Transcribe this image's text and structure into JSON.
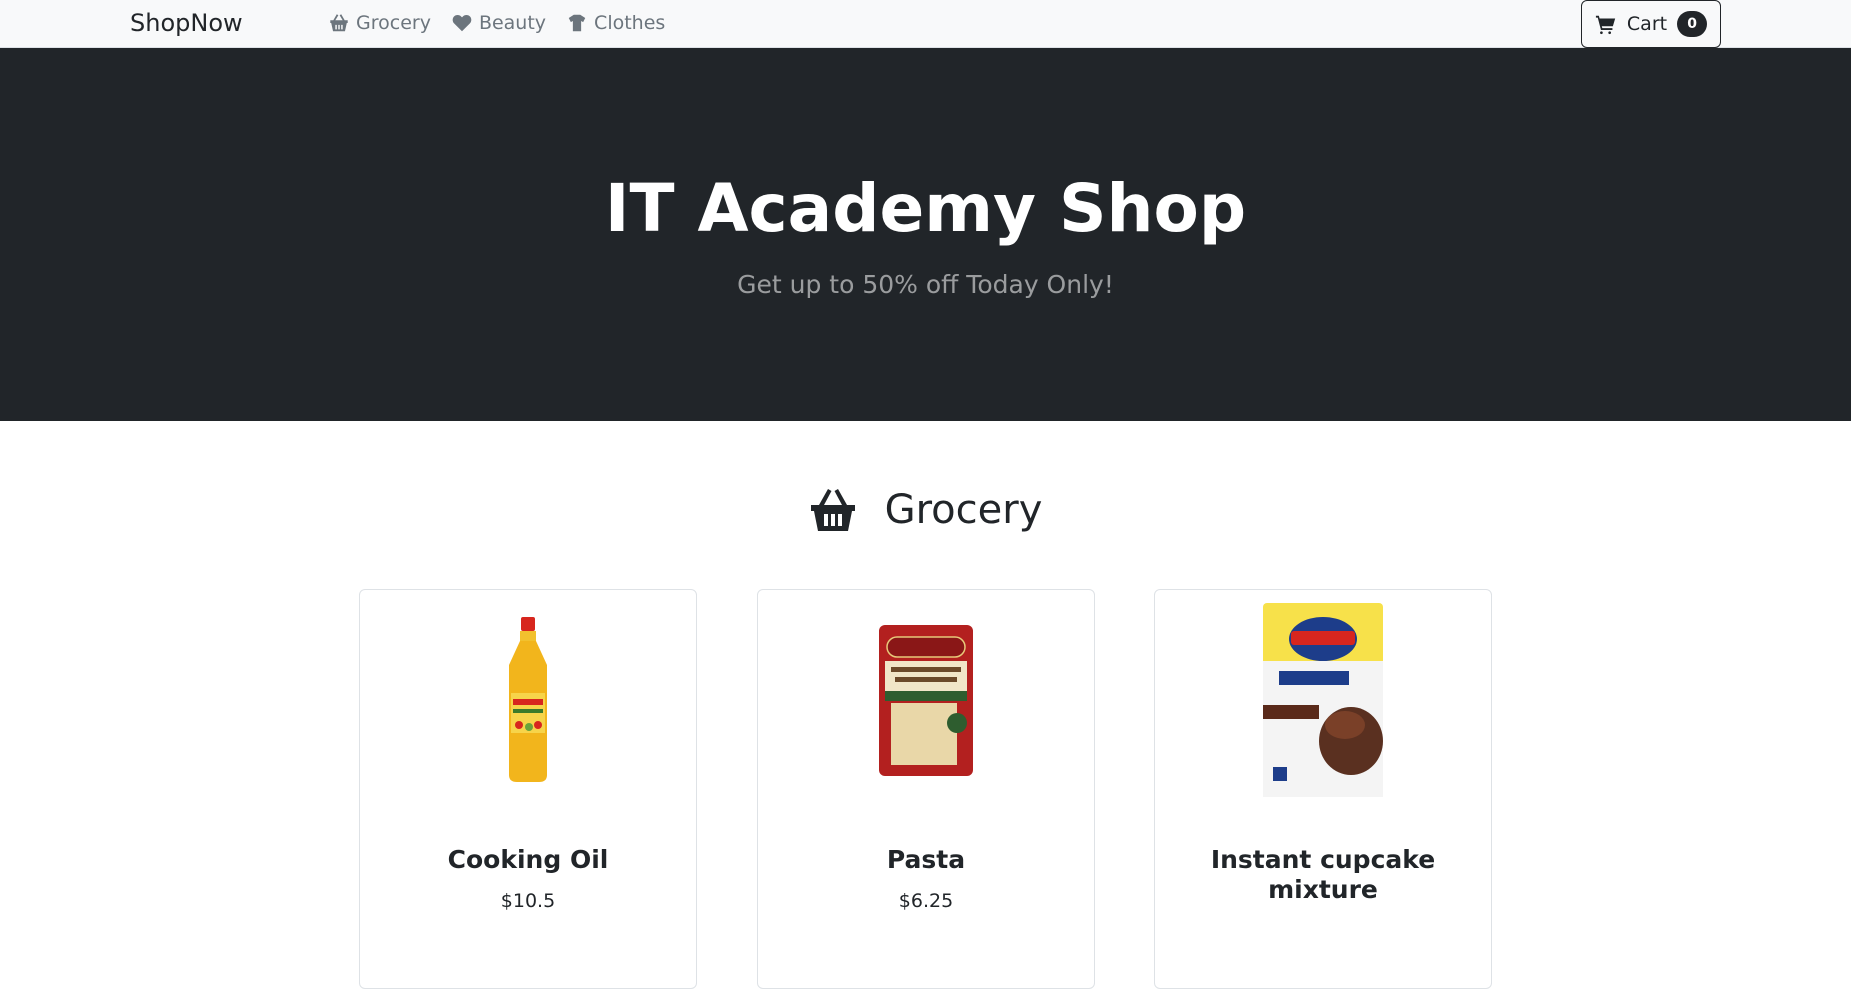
{
  "nav": {
    "brand": "ShopNow",
    "links": [
      {
        "label": "Grocery",
        "icon": "basket-icon"
      },
      {
        "label": "Beauty",
        "icon": "heart-icon"
      },
      {
        "label": "Clothes",
        "icon": "shirt-icon"
      }
    ],
    "cart": {
      "label": "Cart",
      "count": "0",
      "icon": "cart-icon"
    }
  },
  "hero": {
    "title": "IT Academy Shop",
    "subtitle": "Get up to 50% off Today Only!"
  },
  "section": {
    "title": "Grocery",
    "icon": "basket-icon"
  },
  "products": [
    {
      "name": "Cooking Oil",
      "price": "$10.5"
    },
    {
      "name": "Pasta",
      "price": "$6.25"
    },
    {
      "name": "Instant cupcake mixture",
      "price": ""
    }
  ],
  "colors": {
    "navbar_bg": "#f8f9fa",
    "hero_bg": "#212529",
    "text": "#212529",
    "muted": "#6c757d"
  }
}
